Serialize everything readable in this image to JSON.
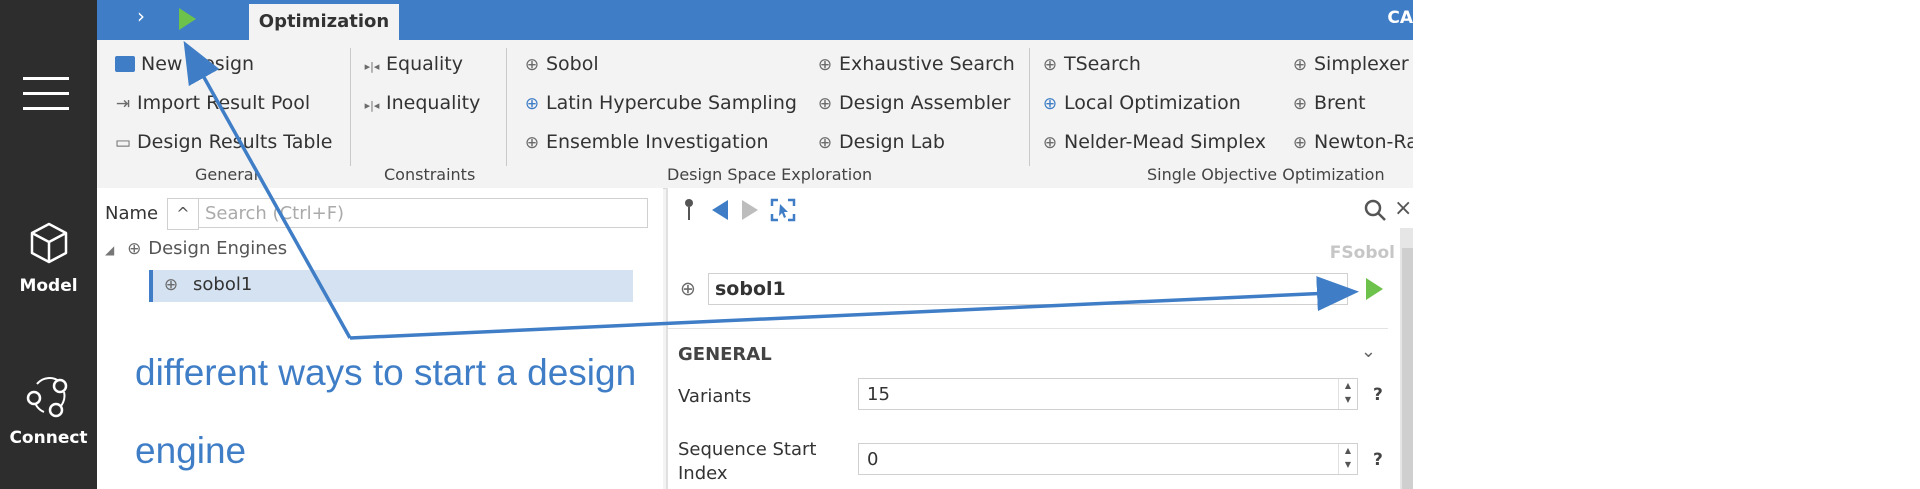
{
  "topbar": {
    "tab": "Optimization",
    "right_text": "CA"
  },
  "sidebar": {
    "items": [
      {
        "label": "Model",
        "icon": "cube-icon"
      },
      {
        "label": "Connect",
        "icon": "network-icon"
      }
    ]
  },
  "ribbon": {
    "general": {
      "label": "General",
      "new_design": "New Design",
      "import_result_pool": "Import Result Pool",
      "design_results_table": "Design Results Table"
    },
    "constraints": {
      "label": "Constraints",
      "equality": "Equality",
      "inequality": "Inequality"
    },
    "dse": {
      "label": "Design Space Exploration",
      "sobol": "Sobol",
      "lhs": "Latin Hypercube Sampling",
      "ensemble": "Ensemble Investigation",
      "exhaustive": "Exhaustive Search",
      "assembler": "Design Assembler",
      "lab": "Design Lab"
    },
    "soo": {
      "label": "Single Objective Optimization",
      "tsearch": "TSearch",
      "local": "Local Optimization",
      "nelder": "Nelder-Mead Simplex",
      "simplexer": "Simplexer",
      "brent": "Brent",
      "newton": "Newton-Raphson"
    }
  },
  "tree": {
    "name_label": "Name",
    "sort_icon": "caret-up-icon",
    "search_placeholder": "Search (Ctrl+F)",
    "root": "Design Engines",
    "child": "sobol1"
  },
  "annotation": {
    "line1": "different ways to start a design",
    "line2": "engine",
    "color": "#3f7ec6"
  },
  "props": {
    "engine_name": "sobol1",
    "type_label": "FSobol",
    "section": "GENERAL",
    "variants_label": "Variants",
    "variants_value": "15",
    "seq_label_1": "Sequence Start",
    "seq_label_2": "Index",
    "seq_value": "0",
    "help": "?"
  }
}
